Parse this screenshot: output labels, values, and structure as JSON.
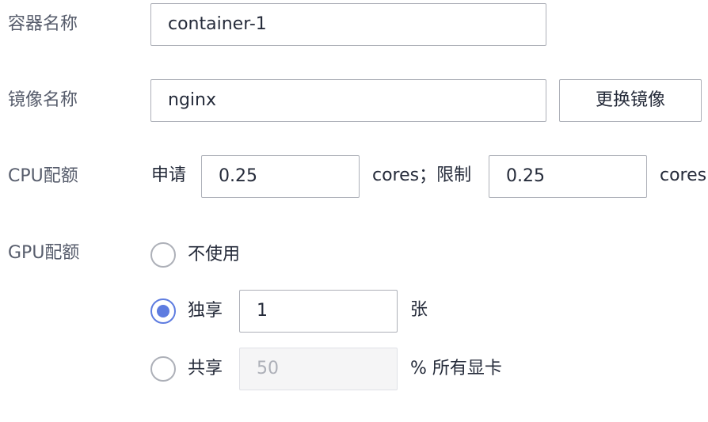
{
  "container_name": {
    "label": "容器名称",
    "value": "container-1"
  },
  "image_name": {
    "label": "镜像名称",
    "value": "nginx",
    "change_button": "更换镜像"
  },
  "cpu_quota": {
    "label": "CPU配额",
    "request_label": "申请",
    "request_value": "0.25",
    "unit_and_limit_label": "cores；限制",
    "limit_value": "0.25",
    "limit_unit": "cores"
  },
  "gpu_quota": {
    "label": "GPU配额",
    "selected": "exclusive",
    "options": [
      {
        "id": "none",
        "label": "不使用"
      },
      {
        "id": "exclusive",
        "label": "独享",
        "value": "1",
        "unit": "张"
      },
      {
        "id": "shared",
        "label": "共享",
        "placeholder": "50",
        "unit": "% 所有显卡"
      }
    ]
  },
  "colors": {
    "accent": "#5e7ce0",
    "border": "#adb0b8",
    "label_text": "#575d6c",
    "disabled_bg": "#f5f5f6"
  }
}
